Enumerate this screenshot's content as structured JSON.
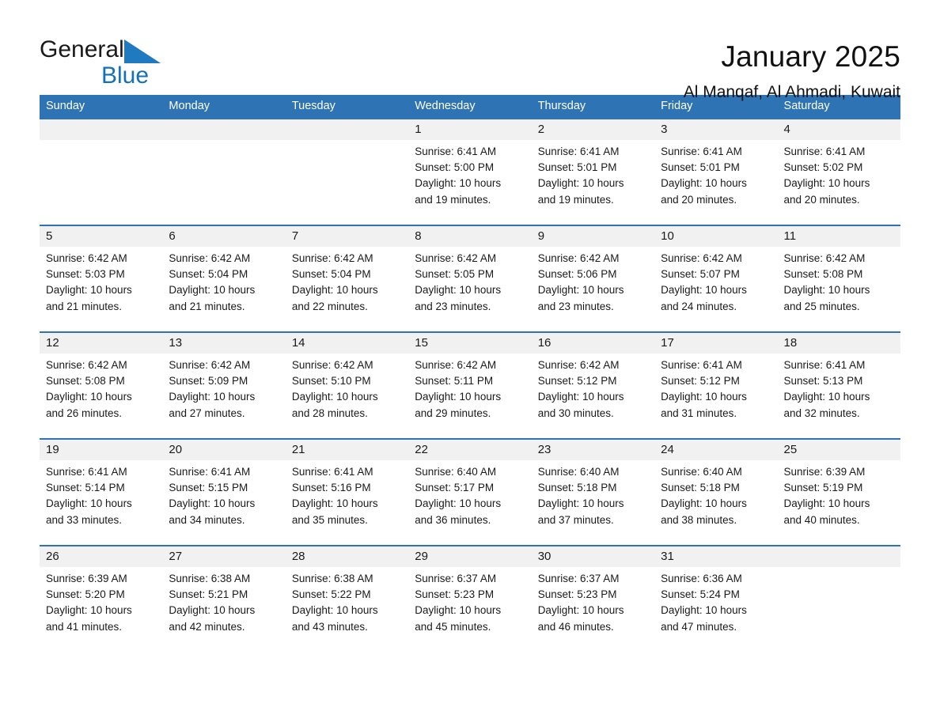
{
  "brand": {
    "name_part1": "General",
    "name_part2": "Blue",
    "triangle_color": "#1f7ac0",
    "blue_color": "#1371b8"
  },
  "header": {
    "title": "January 2025",
    "subtitle": "Al Manqaf, Al Ahmadi, Kuwait"
  },
  "theme": {
    "header_blue": "#2e74b5",
    "row_band_gray": "#f1f1f1",
    "text_black": "#1a1a1a"
  },
  "weekdays": [
    "Sunday",
    "Monday",
    "Tuesday",
    "Wednesday",
    "Thursday",
    "Friday",
    "Saturday"
  ],
  "weeks": [
    {
      "days": [
        {
          "num": "",
          "sunrise": "",
          "sunset": "",
          "daylight1": "",
          "daylight2": ""
        },
        {
          "num": "",
          "sunrise": "",
          "sunset": "",
          "daylight1": "",
          "daylight2": ""
        },
        {
          "num": "",
          "sunrise": "",
          "sunset": "",
          "daylight1": "",
          "daylight2": ""
        },
        {
          "num": "1",
          "sunrise": "Sunrise: 6:41 AM",
          "sunset": "Sunset: 5:00 PM",
          "daylight1": "Daylight: 10 hours",
          "daylight2": "and 19 minutes."
        },
        {
          "num": "2",
          "sunrise": "Sunrise: 6:41 AM",
          "sunset": "Sunset: 5:01 PM",
          "daylight1": "Daylight: 10 hours",
          "daylight2": "and 19 minutes."
        },
        {
          "num": "3",
          "sunrise": "Sunrise: 6:41 AM",
          "sunset": "Sunset: 5:01 PM",
          "daylight1": "Daylight: 10 hours",
          "daylight2": "and 20 minutes."
        },
        {
          "num": "4",
          "sunrise": "Sunrise: 6:41 AM",
          "sunset": "Sunset: 5:02 PM",
          "daylight1": "Daylight: 10 hours",
          "daylight2": "and 20 minutes."
        }
      ]
    },
    {
      "days": [
        {
          "num": "5",
          "sunrise": "Sunrise: 6:42 AM",
          "sunset": "Sunset: 5:03 PM",
          "daylight1": "Daylight: 10 hours",
          "daylight2": "and 21 minutes."
        },
        {
          "num": "6",
          "sunrise": "Sunrise: 6:42 AM",
          "sunset": "Sunset: 5:04 PM",
          "daylight1": "Daylight: 10 hours",
          "daylight2": "and 21 minutes."
        },
        {
          "num": "7",
          "sunrise": "Sunrise: 6:42 AM",
          "sunset": "Sunset: 5:04 PM",
          "daylight1": "Daylight: 10 hours",
          "daylight2": "and 22 minutes."
        },
        {
          "num": "8",
          "sunrise": "Sunrise: 6:42 AM",
          "sunset": "Sunset: 5:05 PM",
          "daylight1": "Daylight: 10 hours",
          "daylight2": "and 23 minutes."
        },
        {
          "num": "9",
          "sunrise": "Sunrise: 6:42 AM",
          "sunset": "Sunset: 5:06 PM",
          "daylight1": "Daylight: 10 hours",
          "daylight2": "and 23 minutes."
        },
        {
          "num": "10",
          "sunrise": "Sunrise: 6:42 AM",
          "sunset": "Sunset: 5:07 PM",
          "daylight1": "Daylight: 10 hours",
          "daylight2": "and 24 minutes."
        },
        {
          "num": "11",
          "sunrise": "Sunrise: 6:42 AM",
          "sunset": "Sunset: 5:08 PM",
          "daylight1": "Daylight: 10 hours",
          "daylight2": "and 25 minutes."
        }
      ]
    },
    {
      "days": [
        {
          "num": "12",
          "sunrise": "Sunrise: 6:42 AM",
          "sunset": "Sunset: 5:08 PM",
          "daylight1": "Daylight: 10 hours",
          "daylight2": "and 26 minutes."
        },
        {
          "num": "13",
          "sunrise": "Sunrise: 6:42 AM",
          "sunset": "Sunset: 5:09 PM",
          "daylight1": "Daylight: 10 hours",
          "daylight2": "and 27 minutes."
        },
        {
          "num": "14",
          "sunrise": "Sunrise: 6:42 AM",
          "sunset": "Sunset: 5:10 PM",
          "daylight1": "Daylight: 10 hours",
          "daylight2": "and 28 minutes."
        },
        {
          "num": "15",
          "sunrise": "Sunrise: 6:42 AM",
          "sunset": "Sunset: 5:11 PM",
          "daylight1": "Daylight: 10 hours",
          "daylight2": "and 29 minutes."
        },
        {
          "num": "16",
          "sunrise": "Sunrise: 6:42 AM",
          "sunset": "Sunset: 5:12 PM",
          "daylight1": "Daylight: 10 hours",
          "daylight2": "and 30 minutes."
        },
        {
          "num": "17",
          "sunrise": "Sunrise: 6:41 AM",
          "sunset": "Sunset: 5:12 PM",
          "daylight1": "Daylight: 10 hours",
          "daylight2": "and 31 minutes."
        },
        {
          "num": "18",
          "sunrise": "Sunrise: 6:41 AM",
          "sunset": "Sunset: 5:13 PM",
          "daylight1": "Daylight: 10 hours",
          "daylight2": "and 32 minutes."
        }
      ]
    },
    {
      "days": [
        {
          "num": "19",
          "sunrise": "Sunrise: 6:41 AM",
          "sunset": "Sunset: 5:14 PM",
          "daylight1": "Daylight: 10 hours",
          "daylight2": "and 33 minutes."
        },
        {
          "num": "20",
          "sunrise": "Sunrise: 6:41 AM",
          "sunset": "Sunset: 5:15 PM",
          "daylight1": "Daylight: 10 hours",
          "daylight2": "and 34 minutes."
        },
        {
          "num": "21",
          "sunrise": "Sunrise: 6:41 AM",
          "sunset": "Sunset: 5:16 PM",
          "daylight1": "Daylight: 10 hours",
          "daylight2": "and 35 minutes."
        },
        {
          "num": "22",
          "sunrise": "Sunrise: 6:40 AM",
          "sunset": "Sunset: 5:17 PM",
          "daylight1": "Daylight: 10 hours",
          "daylight2": "and 36 minutes."
        },
        {
          "num": "23",
          "sunrise": "Sunrise: 6:40 AM",
          "sunset": "Sunset: 5:18 PM",
          "daylight1": "Daylight: 10 hours",
          "daylight2": "and 37 minutes."
        },
        {
          "num": "24",
          "sunrise": "Sunrise: 6:40 AM",
          "sunset": "Sunset: 5:18 PM",
          "daylight1": "Daylight: 10 hours",
          "daylight2": "and 38 minutes."
        },
        {
          "num": "25",
          "sunrise": "Sunrise: 6:39 AM",
          "sunset": "Sunset: 5:19 PM",
          "daylight1": "Daylight: 10 hours",
          "daylight2": "and 40 minutes."
        }
      ]
    },
    {
      "days": [
        {
          "num": "26",
          "sunrise": "Sunrise: 6:39 AM",
          "sunset": "Sunset: 5:20 PM",
          "daylight1": "Daylight: 10 hours",
          "daylight2": "and 41 minutes."
        },
        {
          "num": "27",
          "sunrise": "Sunrise: 6:38 AM",
          "sunset": "Sunset: 5:21 PM",
          "daylight1": "Daylight: 10 hours",
          "daylight2": "and 42 minutes."
        },
        {
          "num": "28",
          "sunrise": "Sunrise: 6:38 AM",
          "sunset": "Sunset: 5:22 PM",
          "daylight1": "Daylight: 10 hours",
          "daylight2": "and 43 minutes."
        },
        {
          "num": "29",
          "sunrise": "Sunrise: 6:37 AM",
          "sunset": "Sunset: 5:23 PM",
          "daylight1": "Daylight: 10 hours",
          "daylight2": "and 45 minutes."
        },
        {
          "num": "30",
          "sunrise": "Sunrise: 6:37 AM",
          "sunset": "Sunset: 5:23 PM",
          "daylight1": "Daylight: 10 hours",
          "daylight2": "and 46 minutes."
        },
        {
          "num": "31",
          "sunrise": "Sunrise: 6:36 AM",
          "sunset": "Sunset: 5:24 PM",
          "daylight1": "Daylight: 10 hours",
          "daylight2": "and 47 minutes."
        },
        {
          "num": "",
          "sunrise": "",
          "sunset": "",
          "daylight1": "",
          "daylight2": ""
        }
      ]
    }
  ]
}
